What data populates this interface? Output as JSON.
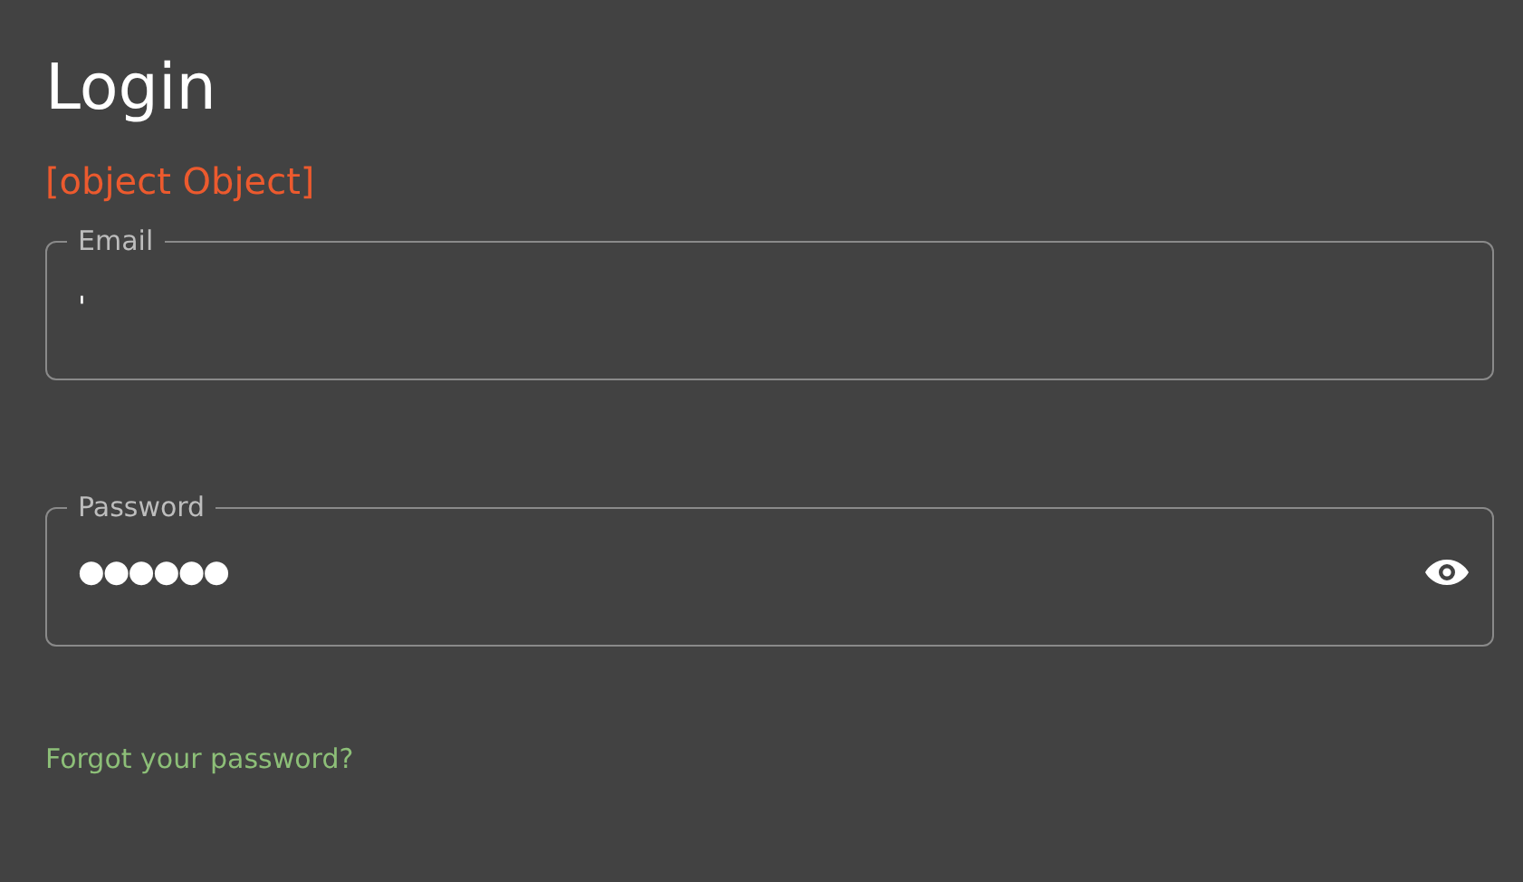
{
  "title": "Login",
  "error": "[object Object]",
  "fields": [
    {
      "kind": "text",
      "label": "Email",
      "value": "'"
    },
    {
      "kind": "password",
      "label": "Password",
      "value": "●●●●●●"
    }
  ],
  "link": "Forgot your password?"
}
